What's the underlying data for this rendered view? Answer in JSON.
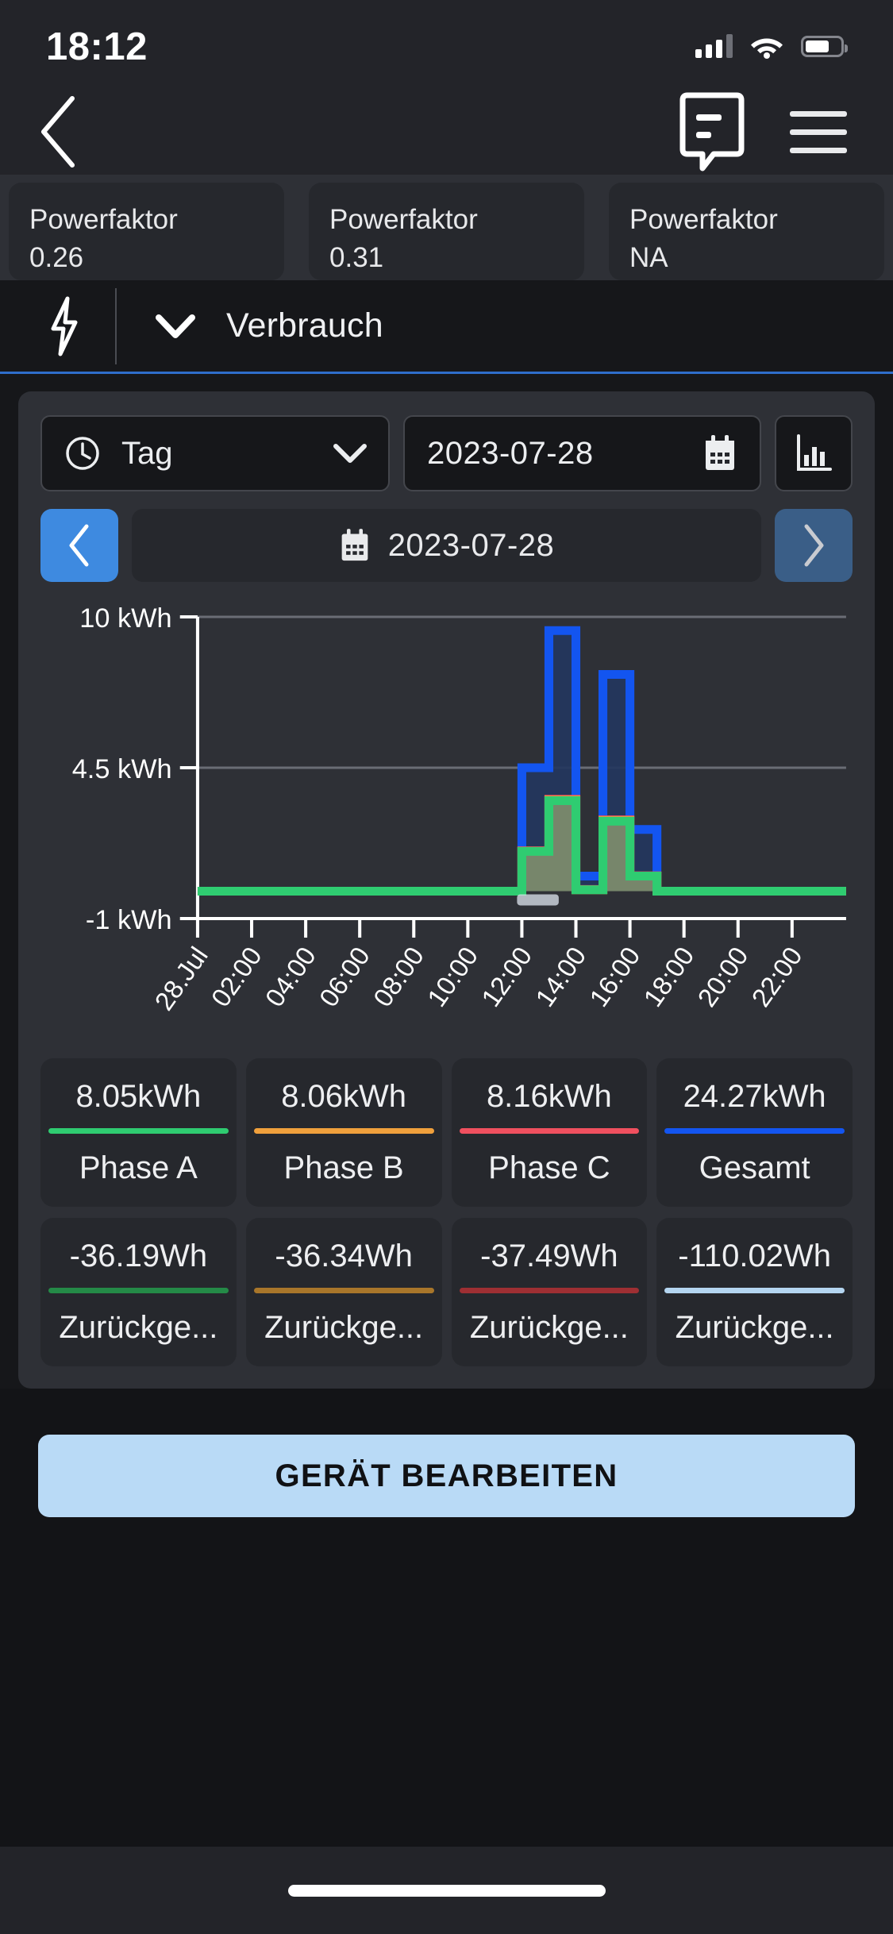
{
  "status_bar": {
    "time": "18:12",
    "signal_icon": "cellular-signal-icon",
    "wifi_icon": "wifi-icon",
    "battery_icon": "battery-icon"
  },
  "nav_bar": {
    "back_icon": "chevron-left-icon",
    "message_icon": "message-bubble-icon",
    "menu_icon": "hamburger-menu-icon"
  },
  "power_factor_cards": [
    {
      "title": "Powerfaktor",
      "value": "0.26"
    },
    {
      "title": "Powerfaktor",
      "value": "0.31"
    },
    {
      "title": "Powerfaktor",
      "value": "NA"
    }
  ],
  "section_tab": {
    "bolt_icon": "lightning-bolt-icon",
    "chevron_icon": "chevron-down-icon",
    "label": "Verbrauch",
    "accent_color": "#2f6ecb"
  },
  "controls": {
    "period": {
      "icon": "clock-icon",
      "value": "Tag",
      "chevron_icon": "chevron-down-icon"
    },
    "date": {
      "value": "2023-07-28",
      "icon": "calendar-icon"
    },
    "chart_toggle": {
      "icon": "bar-chart-icon"
    },
    "prev_button": {
      "icon": "chevron-left-icon",
      "color": "#3e8ae0"
    },
    "next_button": {
      "icon": "chevron-right-icon",
      "color": "#3a5e87"
    },
    "date_display": {
      "icon": "calendar-icon",
      "value": "2023-07-28"
    }
  },
  "chart_data": {
    "type": "area",
    "title": "",
    "xlabel": "",
    "ylabel": "",
    "ylim": [
      -1,
      10
    ],
    "yticks": [
      -1,
      4.5,
      10
    ],
    "ytick_labels": [
      "-1 kWh",
      "4.5 kWh",
      "10 kWh"
    ],
    "grid": true,
    "legend_position": "below-as-cards",
    "x_tick_labels": [
      "28.Jul",
      "02:00",
      "04:00",
      "06:00",
      "08:00",
      "10:00",
      "12:00",
      "14:00",
      "16:00",
      "18:00",
      "20:00",
      "22:00"
    ],
    "x_hours": [
      0,
      2,
      4,
      6,
      8,
      10,
      12,
      14,
      16,
      18,
      20,
      22
    ],
    "series": [
      {
        "name": "Gesamt",
        "color": "#1355f0",
        "fill": "#24375e",
        "values": [
          0,
          0,
          0,
          0,
          0,
          0,
          0,
          0,
          0,
          0,
          0,
          0,
          4.5,
          9.5,
          0.55,
          7.9,
          2.25,
          0,
          0,
          0,
          0,
          0,
          0,
          0
        ]
      },
      {
        "name": "Phase A",
        "color": "#2fcc71",
        "fill": "#7f8d6d",
        "values": [
          0,
          0,
          0,
          0,
          0,
          0,
          0,
          0,
          0,
          0,
          0,
          0,
          1.45,
          3.3,
          0.05,
          2.55,
          0.55,
          0,
          0,
          0,
          0,
          0,
          0,
          0
        ]
      },
      {
        "name": "Phase B",
        "color": "#f0a03c",
        "fill": "transparent",
        "values": [
          0,
          0,
          0,
          0,
          0,
          0,
          0,
          0,
          0,
          0,
          0,
          0,
          1.45,
          3.32,
          0.05,
          2.57,
          0.55,
          0,
          0,
          0,
          0,
          0,
          0,
          0
        ]
      },
      {
        "name": "Phase C",
        "color": "#f0505f",
        "fill": "transparent",
        "values": [
          0,
          0,
          0,
          0,
          0,
          0,
          0,
          0,
          0,
          0,
          0,
          0,
          1.47,
          3.35,
          0.06,
          2.6,
          0.56,
          0,
          0,
          0,
          0,
          0,
          0,
          0
        ]
      }
    ]
  },
  "stats_row_1": [
    {
      "value": "8.05kWh",
      "label": "Phase A",
      "color": "#2fcc71"
    },
    {
      "value": "8.06kWh",
      "label": "Phase B",
      "color": "#f0a03c"
    },
    {
      "value": "8.16kWh",
      "label": "Phase C",
      "color": "#f0505f"
    },
    {
      "value": "24.27kWh",
      "label": "Gesamt",
      "color": "#1355f0"
    }
  ],
  "stats_row_2": [
    {
      "value": "-36.19Wh",
      "label": "Zurückge...",
      "color": "#248a47"
    },
    {
      "value": "-36.34Wh",
      "label": "Zurückge...",
      "color": "#a8762a"
    },
    {
      "value": "-37.49Wh",
      "label": "Zurückge...",
      "color": "#9e2f33"
    },
    {
      "value": "-110.02Wh",
      "label": "Zurückge...",
      "color": "#b4d5f0"
    }
  ],
  "cta": {
    "label": "GERÄT BEARBEITEN",
    "background": "#b9daf6"
  }
}
